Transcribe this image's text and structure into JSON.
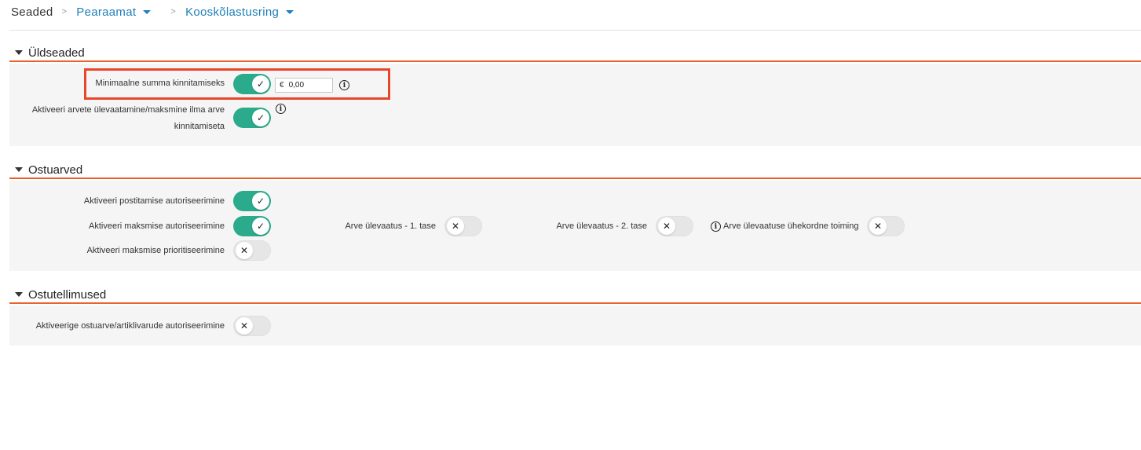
{
  "breadcrumb": {
    "root": "Seaded",
    "sep": ">",
    "item1": "Pearaamat",
    "item2": "Kooskõlastusring"
  },
  "sections": {
    "general": {
      "title": "Üldseaded",
      "min_sum_label": "Minimaalne summa kinnitamiseks",
      "min_sum_toggle": true,
      "currency": "€",
      "amount": "0,00",
      "review_label": "Aktiveeri arvete ülevaatamine/maksmine ilma arve kinnitamiseta",
      "review_toggle": true
    },
    "purchase_invoices": {
      "title": "Ostuarved",
      "posting_auth_label": "Aktiveeri postitamise autoriseerimine",
      "posting_auth_toggle": true,
      "payment_auth_label": "Aktiveeri maksmise autoriseerimine",
      "payment_auth_toggle": true,
      "payment_priority_label": "Aktiveeri maksmise prioritiseerimine",
      "payment_priority_toggle": false,
      "review_level1_label": "Arve ülevaatus - 1. tase",
      "review_level1_toggle": false,
      "review_level2_label": "Arve ülevaatus - 2. tase",
      "review_level2_toggle": false,
      "review_once_label": "Arve ülevaatuse ühekordne toiming",
      "review_once_toggle": false
    },
    "purchase_orders": {
      "title": "Ostutellimused",
      "order_auth_label": "Aktiveerige ostuarve/artiklivarude autoriseerimine",
      "order_auth_toggle": false
    }
  },
  "glyphs": {
    "check": "✓",
    "cross": "✕",
    "info": "i"
  },
  "colors": {
    "accent": "#e8622c",
    "toggle_on": "#2bab8c",
    "link": "#1f7fb8",
    "highlight": "#e8462a"
  }
}
